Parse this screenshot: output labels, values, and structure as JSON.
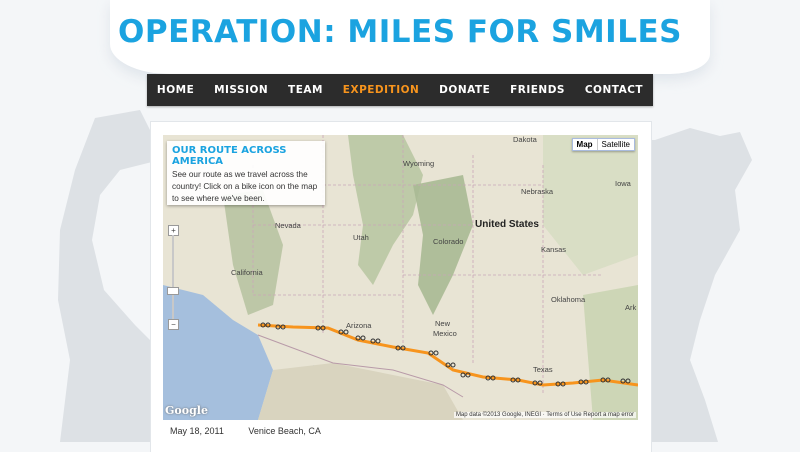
{
  "site_title": "OPERATION: MILES FOR SMILES",
  "nav": {
    "items": [
      "HOME",
      "MISSION",
      "TEAM",
      "EXPEDITION",
      "DONATE",
      "FRIENDS",
      "CONTACT"
    ],
    "active": "EXPEDITION"
  },
  "map": {
    "info_title": "Our Route Across America",
    "info_text": "See our route as we travel across the country! Click on a bike icon on the map to see where we've been.",
    "map_button": "Map",
    "satellite_button": "Satellite",
    "zoom_in": "+",
    "zoom_out": "−",
    "google_logo": "Google",
    "attribution": "Map data ©2013 Google, INEGI · Terms of Use  Report a map error",
    "labels": {
      "country": "United States",
      "dakota": "Dakota",
      "wyoming": "Wyoming",
      "nebraska": "Nebraska",
      "iowa": "Iowa",
      "nevada": "Nevada",
      "utah": "Utah",
      "colorado": "Colorado",
      "kansas": "Kansas",
      "california": "California",
      "oklahoma": "Oklahoma",
      "arizona": "Arizona",
      "new_mexico_1": "New",
      "new_mexico_2": "Mexico",
      "texas": "Texas",
      "ark": "Ark"
    },
    "route_color": "#f7941d"
  },
  "entry": {
    "date": "May 18, 2011",
    "location": "Venice Beach, CA"
  },
  "colors": {
    "brand": "#1ba3e0",
    "nav_bg": "#2c2c2c",
    "nav_active": "#f7941d"
  }
}
